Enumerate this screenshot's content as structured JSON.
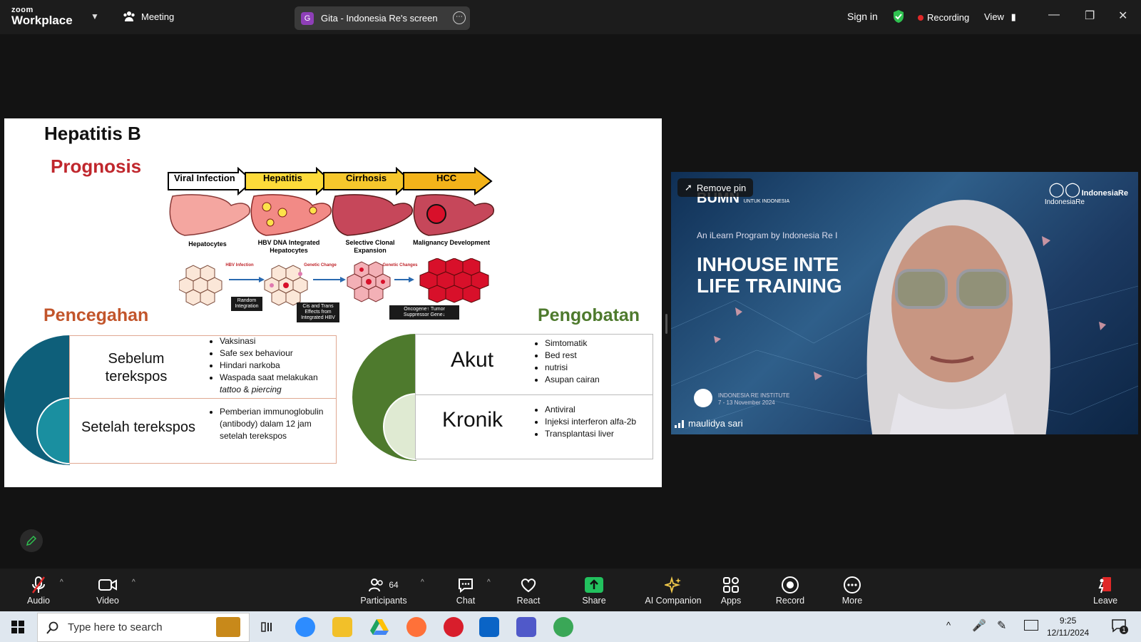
{
  "app": {
    "brand_top": "zoom",
    "brand_bottom": "Workplace",
    "meeting_label": "Meeting"
  },
  "screen_share": {
    "badge": "G",
    "title": "Gita - Indonesia Re's screen"
  },
  "header": {
    "sign_in": "Sign in",
    "recording": "Recording",
    "view": "View"
  },
  "slide": {
    "title": "Hepatitis B",
    "prognosis": "Prognosis",
    "stages": [
      "Viral Infection",
      "Hepatitis",
      "Cirrhosis",
      "HCC"
    ],
    "stage_labels": [
      "Hepatocytes",
      "HBV DNA Integrated Hepatocytes",
      "Selective Clonal Expansion",
      "Malignancy Development"
    ],
    "arrow_labels": [
      "HBV Infection",
      "Genetic Change",
      "Genetic Changes"
    ],
    "tags": [
      "Random Integration",
      "Cis and Trans Effects from Integrated HBV",
      "Oncogene↑ Tumor Suppressor Gene↓"
    ],
    "pencegahan": {
      "title": "Pencegahan",
      "before_label": "Sebelum terekspos",
      "before_items": [
        "Vaksinasi",
        "Safe sex behaviour",
        "Hindari narkoba",
        "Waspada saat melakukan"
      ],
      "before_tail_1": "tattoo",
      "before_tail_and": " & ",
      "before_tail_2": "piercing",
      "after_label": "Setelah terekspos",
      "after_items": [
        "Pemberian immunoglobulin (antibody) dalam 12 jam setelah terekspos"
      ]
    },
    "pengobatan": {
      "title": "Pengobatan",
      "acute_label": "Akut",
      "acute_items": [
        "Simtomatik",
        "Bed rest",
        "nutrisi",
        "Asupan cairan"
      ],
      "chronic_label": "Kronik",
      "chronic_items": [
        "Antiviral",
        "Injeksi interferon alfa-2b",
        "Transplantasi liver"
      ]
    }
  },
  "video": {
    "remove_pin": "Remove pin",
    "bumn": "BUMN",
    "bumn_sub": "UNTUK INDONESIA",
    "logo_left": "IndonesiaRe",
    "logo_right": "IndonesiaRe",
    "program": "An iLearn Program by Indonesia Re I",
    "headline_1": "INHOUSE INTE",
    "headline_2": "LIFE TRAINING",
    "institute": "INDONESIA RE INSTITUTE",
    "dates": "7 - 13 November 2024",
    "participant_name": "maulidya sari"
  },
  "toolbar": {
    "audio": "Audio",
    "video": "Video",
    "participants": "Participants",
    "participants_count": "64",
    "chat": "Chat",
    "react": "React",
    "share": "Share",
    "ai": "AI Companion",
    "apps": "Apps",
    "record": "Record",
    "more": "More",
    "leave": "Leave"
  },
  "taskbar": {
    "search_placeholder": "Type here to search",
    "time": "9:25",
    "date": "12/11/2024",
    "notif_count": "1"
  },
  "colors": {
    "prognosis": "#c0272d",
    "pencegahan": "#c2552b",
    "pengobatan": "#4e7a2d",
    "teal": "#0e5f7a",
    "green": "#4e7a2d",
    "share": "#22c15e",
    "recording": "#e02828"
  }
}
